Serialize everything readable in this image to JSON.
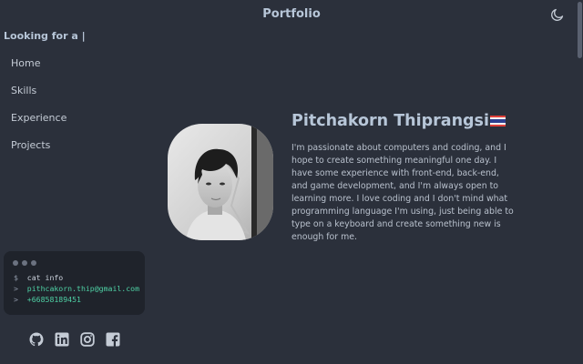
{
  "header": {
    "title": "Portfolio",
    "theme_icon": "moon-icon"
  },
  "sidebar": {
    "typing_text": "Looking for a |",
    "nav": [
      {
        "label": "Home"
      },
      {
        "label": "Skills"
      },
      {
        "label": "Experience"
      },
      {
        "label": "Projects"
      }
    ]
  },
  "terminal": {
    "prompt_symbol": "$",
    "command": "cat info",
    "arrow_symbol": ">",
    "email": "pithcakorn.thip@gmail.com",
    "phone": "+66858189451"
  },
  "socials": [
    {
      "icon": "github-icon"
    },
    {
      "icon": "linkedin-icon"
    },
    {
      "icon": "instagram-icon"
    },
    {
      "icon": "facebook-icon"
    }
  ],
  "profile": {
    "name": "Pitchakorn Thiprangsi",
    "flag_icon": "thailand-flag-icon",
    "bio": "I'm passionate about computers and coding, and I hope to create something meaningful one day. I have some experience with front-end, back-end, and game development, and I'm always open to learning more. I love coding and I don't mind what programming language I'm using, just being able to type on a keyboard and create something new is enough for me."
  },
  "colors": {
    "background": "#2b303b",
    "accent": "#b7c6d8",
    "terminal_bg": "#1f232b",
    "terminal_green": "#4fd1a5"
  }
}
